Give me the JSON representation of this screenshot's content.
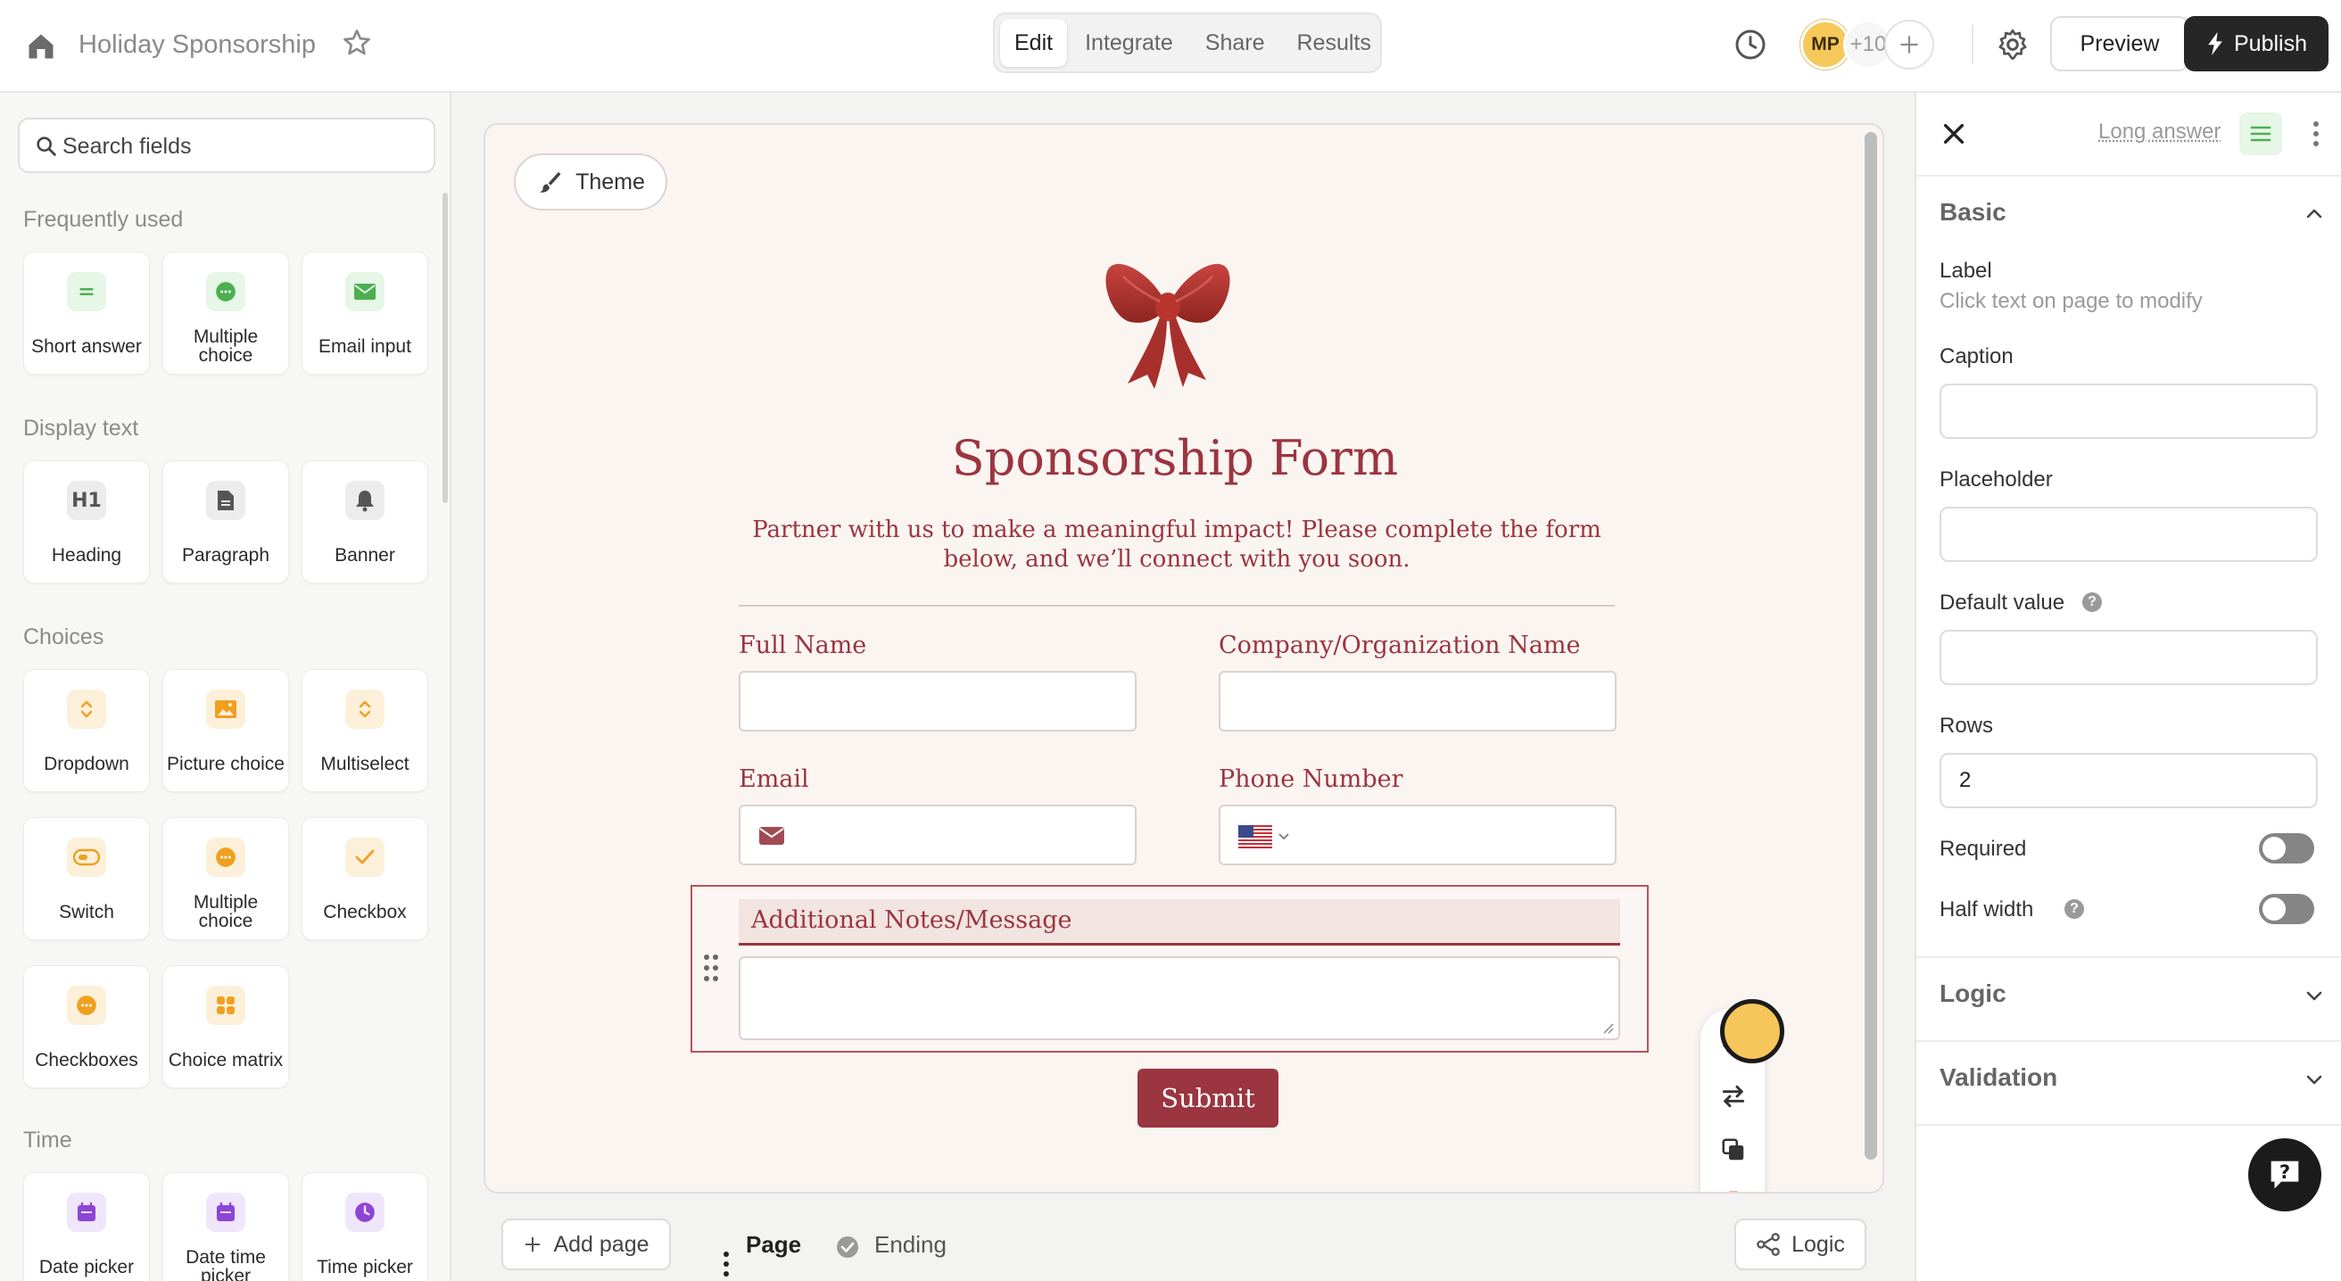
{
  "header": {
    "form_title": "Holiday Sponsorship",
    "tabs": [
      {
        "label": "Edit",
        "active": true
      },
      {
        "label": "Integrate",
        "active": false
      },
      {
        "label": "Share",
        "active": false
      },
      {
        "label": "Results",
        "active": false
      }
    ],
    "avatar_initials": "MP",
    "more_collaborators": "+10",
    "preview_label": "Preview",
    "publish_label": "Publish",
    "icons": [
      "home-icon",
      "star-icon",
      "clock-icon",
      "plus-icon",
      "gear-icon",
      "bolt-icon"
    ]
  },
  "sidebar": {
    "search_placeholder": "Search fields",
    "sections": [
      {
        "title": "Frequently used",
        "items": [
          {
            "label": "Short answer",
            "icon": "short-answer-icon",
            "color": "#4caf50"
          },
          {
            "label": "Multiple choice",
            "icon": "radio-icon",
            "color": "#4caf50"
          },
          {
            "label": "Email input",
            "icon": "mail-icon",
            "color": "#4caf50"
          }
        ]
      },
      {
        "title": "Display text",
        "items": [
          {
            "label": "Heading",
            "icon": "heading-icon",
            "color": "#555555"
          },
          {
            "label": "Paragraph",
            "icon": "document-icon",
            "color": "#555555"
          },
          {
            "label": "Banner",
            "icon": "bell-icon",
            "color": "#555555"
          }
        ]
      },
      {
        "title": "Choices",
        "items": [
          {
            "label": "Dropdown",
            "icon": "chevrons-icon",
            "color": "#f0a020"
          },
          {
            "label": "Picture choice",
            "icon": "image-icon",
            "color": "#f0a020"
          },
          {
            "label": "Multiselect",
            "icon": "chevrons-icon",
            "color": "#f0a020"
          },
          {
            "label": "Switch",
            "icon": "toggle-icon",
            "color": "#f0a020"
          },
          {
            "label": "Multiple choice",
            "icon": "radio-icon",
            "color": "#f0a020"
          },
          {
            "label": "Checkbox",
            "icon": "check-icon",
            "color": "#f0a020"
          },
          {
            "label": "Checkboxes",
            "icon": "radio-icon",
            "color": "#f0a020"
          },
          {
            "label": "Choice matrix",
            "icon": "grid-icon",
            "color": "#f0a020"
          }
        ]
      },
      {
        "title": "Time",
        "items": [
          {
            "label": "Date picker",
            "icon": "calendar-icon",
            "color": "#8e44d6"
          },
          {
            "label": "Date time picker",
            "icon": "calendar-icon",
            "color": "#8e44d6"
          },
          {
            "label": "Time picker",
            "icon": "clock-icon",
            "color": "#8e44d6"
          }
        ]
      }
    ]
  },
  "canvas": {
    "theme_label": "Theme",
    "form": {
      "heading": "Sponsorship Form",
      "description": "Partner with us to make a meaningful impact! Please complete the form below, and we’ll connect with you soon.",
      "fields": {
        "full_name": "Full Name",
        "company": "Company/Organization Name",
        "email": "Email",
        "phone": "Phone Number",
        "notes": "Additional Notes/Message"
      },
      "submit_label": "Submit",
      "accent_color": "#9b3540",
      "background_color": "#fbf5f2"
    },
    "pages": {
      "add_page_label": "Add page",
      "page_label": "Page",
      "ending_label": "Ending",
      "logic_label": "Logic"
    }
  },
  "right_panel": {
    "field_type": "Long answer",
    "sections": {
      "basic": "Basic",
      "logic": "Logic",
      "validation": "Validation"
    },
    "label_title": "Label",
    "label_hint": "Click text on page to modify",
    "caption_label": "Caption",
    "caption_value": "",
    "placeholder_label": "Placeholder",
    "placeholder_value": "",
    "default_value_label": "Default value",
    "default_value": "",
    "rows_label": "Rows",
    "rows_value": "2",
    "required_label": "Required",
    "required_on": false,
    "half_width_label": "Half width",
    "half_width_on": false
  }
}
